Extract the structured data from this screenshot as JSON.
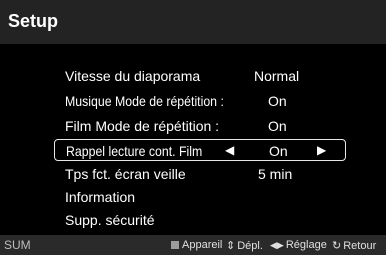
{
  "header": {
    "title": "Setup"
  },
  "menu": {
    "items": [
      {
        "label": "Vitesse du diaporama",
        "value": "Normal"
      },
      {
        "label": "Musique Mode de répétition :",
        "value": "On"
      },
      {
        "label": "Film Mode de répétition  :",
        "value": "On"
      },
      {
        "label": "Rappel lecture cont. Film",
        "value": "On",
        "selected": true
      },
      {
        "label": "Tps fct. écran veille",
        "value": "5 min"
      },
      {
        "label": "Information",
        "value": ""
      },
      {
        "label": "Supp. sécurité",
        "value": ""
      }
    ],
    "left_arrow_icon": "triangle-left-icon",
    "right_arrow_icon": "triangle-right-icon"
  },
  "footer": {
    "source_label": "SUM",
    "hints": {
      "device": "Appareil",
      "move": "Dépl.",
      "adjust": "Réglage",
      "back": "Retour"
    },
    "icons": {
      "device": "gray-square-icon",
      "move": "up-down-arrow-icon",
      "adjust": "left-right-arrow-icon",
      "back": "return-arrow-icon"
    }
  },
  "colors": {
    "title_bar": "#232323",
    "background": "#000000",
    "footer_bar": "#2a2a2a",
    "selection_border": "#e8e8e8"
  }
}
